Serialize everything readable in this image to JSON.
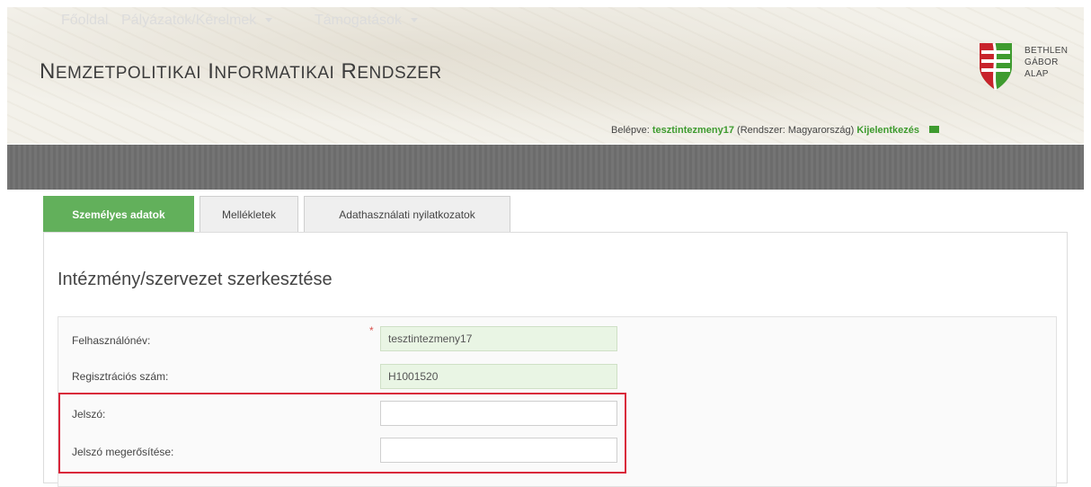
{
  "header": {
    "title_parts": [
      {
        "big": "N",
        "small": "EMZETPOLITIKAI"
      },
      {
        "big": "I",
        "small": "NFORMATIKAI"
      },
      {
        "big": "R",
        "small": "ENDSZER"
      }
    ],
    "logo_lines": [
      "BETHLEN",
      "GÁBOR",
      "ALAP"
    ]
  },
  "login": {
    "prefix": "Belépve:",
    "username": "tesztintezmeny17",
    "system": "(Rendszer: Magyarország)",
    "logout": "Kijelentkezés"
  },
  "nav": {
    "home": "Főoldal",
    "applications": "Pályázatok/Kérelmek",
    "grants": "Támogatások"
  },
  "tabs": [
    {
      "label": "Személyes adatok",
      "active": true
    },
    {
      "label": "Mellékletek",
      "active": false
    },
    {
      "label": "Adathasználati nyilatkozatok",
      "active": false
    }
  ],
  "form": {
    "title": "Intézmény/szervezet szerkesztése",
    "username_label": "Felhasználónév:",
    "username_value": "tesztintezmeny17",
    "reg_label": "Regisztrációs szám:",
    "reg_value": "H1001520",
    "password_label": "Jelszó:",
    "password_value": "",
    "confirm_label": "Jelszó megerősítése:",
    "confirm_value": ""
  },
  "colors": {
    "accent_green": "#3e9b2f",
    "active_tab": "#62b05b",
    "nav_bg": "#6f6f6f",
    "highlight_red": "#d9263a"
  }
}
